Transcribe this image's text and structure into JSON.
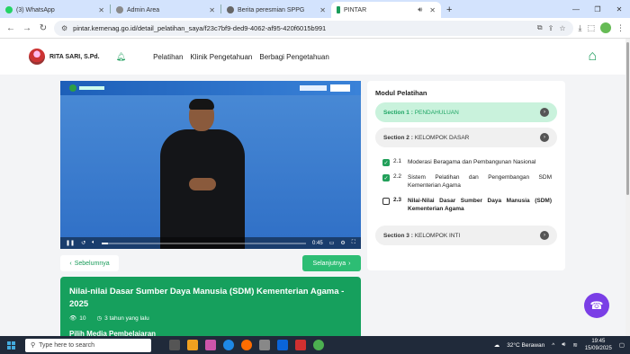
{
  "browser": {
    "tabs": [
      {
        "title": "(3) WhatsApp",
        "color": "#25d366",
        "active": false
      },
      {
        "title": "Admin Area",
        "color": "#8a8a8a",
        "active": false
      },
      {
        "title": "Berita peresmian SPPG",
        "color": "#666666",
        "active": false
      },
      {
        "title": "PINTAR",
        "color": "#1a9c5a",
        "active": true
      }
    ],
    "url": "pintar.kemenag.go.id/detail_pelatihan_saya/f23c7bf9-ded9-4062-af95-420f6015b991"
  },
  "header": {
    "user_name": "RITA SARI, S.Pd.",
    "nav": [
      "Pelatihan",
      "Klinik Pengetahuan",
      "Berbagi Pengetahuan"
    ]
  },
  "video": {
    "time": "0:45"
  },
  "buttons": {
    "prev": "Sebelumnya",
    "next": "Selanjutnya"
  },
  "info": {
    "title": "Nilai-nilai Dasar Sumber Daya Manusia (SDM) Kementerian Agama - 2025",
    "views": "10",
    "age": "3 tahun yang lalu",
    "media_heading": "Pilih Media Pembelajaran"
  },
  "module": {
    "heading": "Modul Pelatihan",
    "sections": [
      {
        "label": "Section 1 :",
        "name": "PENDAHULUAN",
        "active": true
      },
      {
        "label": "Section 2 :",
        "name": "KELOMPOK DASAR",
        "active": false
      },
      {
        "label": "Section 3 :",
        "name": "KELOMPOK INTI",
        "active": false
      }
    ],
    "items": [
      {
        "num": "2.1",
        "text": "Moderasi Beragama dan Pembangunan Nasional",
        "done": true
      },
      {
        "num": "2.2",
        "text": "Sistem Pelatihan dan Pengembangan SDM Kementerian Agama",
        "done": true
      },
      {
        "num": "2.3",
        "text": "Nilai-Nilai Dasar Sumber Daya Manusia (SDM) Kementerian Agama",
        "done": false
      }
    ]
  },
  "taskbar": {
    "search_placeholder": "Type here to search",
    "weather": "32°C  Berawan",
    "time": "19:45",
    "date": "15/09/2025"
  }
}
